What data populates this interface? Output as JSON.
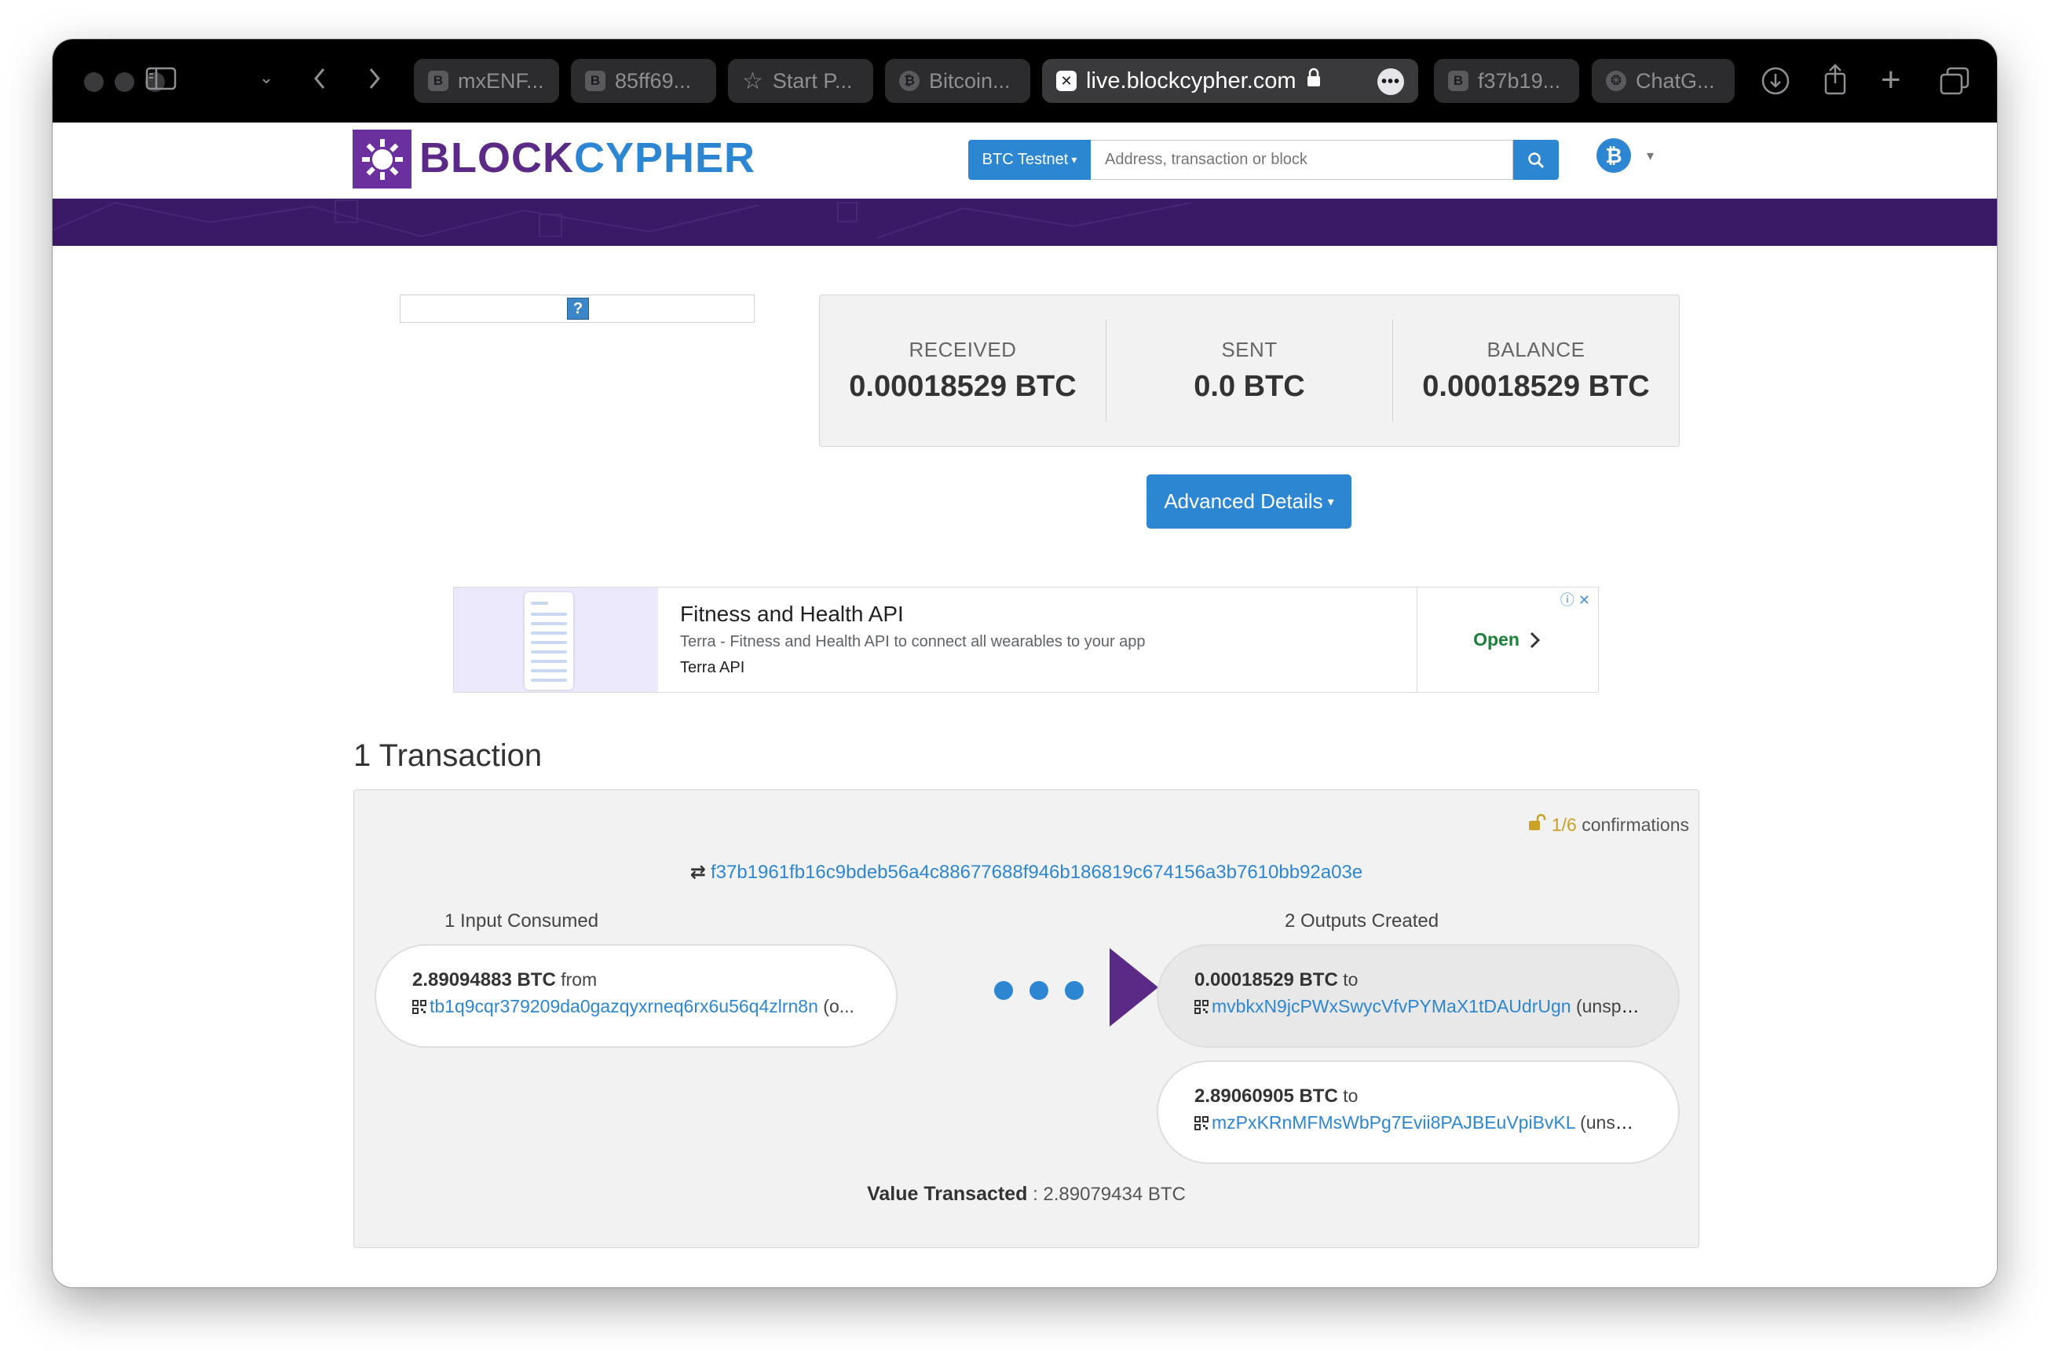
{
  "browser": {
    "tabs": [
      {
        "label": "mxENF...",
        "icon": "B"
      },
      {
        "label": "85ff69...",
        "icon": "B"
      },
      {
        "label": "Start P...",
        "icon": "star-icon"
      },
      {
        "label": "Bitcoin...",
        "icon": "bitcoin-icon"
      },
      {
        "label": "f37b19...",
        "icon": "B"
      },
      {
        "label": "ChatG...",
        "icon": "chatgpt-icon"
      }
    ],
    "active_tab": {
      "url": "live.blockcypher.com"
    }
  },
  "header": {
    "logo": {
      "part1": "BLOCK",
      "part2": "CYPHER"
    },
    "network_label": "BTC Testnet",
    "search_placeholder": "Address, transaction or block"
  },
  "summary": {
    "received": {
      "label": "RECEIVED",
      "value": "0.00018529 BTC"
    },
    "sent": {
      "label": "SENT",
      "value": "0.0 BTC"
    },
    "balance": {
      "label": "BALANCE",
      "value": "0.00018529 BTC"
    }
  },
  "advanced_button": "Advanced Details",
  "qr_help": "?",
  "ad": {
    "title": "Fitness and Health API",
    "description": "Terra - Fitness and Health API to connect all wearables to your app",
    "source": "Terra API",
    "cta": "Open"
  },
  "transactions": {
    "title": "1 Transaction",
    "tx": {
      "confirmations_num": "1/6",
      "confirmations_label": "confirmations",
      "hash": "f37b1961fb16c9bdeb56a4c88677688f946b186819c674156a3b7610bb92a03e",
      "inputs_title": "1 Input Consumed",
      "outputs_title": "2 Outputs Created",
      "inputs": [
        {
          "amount": "2.89094883 BTC",
          "direction": "from",
          "address": "tb1q9cqr379209da0gazqyxrneq6rx6u56q4zlrn8n",
          "status": "(o..."
        }
      ],
      "outputs": [
        {
          "amount": "0.00018529 BTC",
          "direction": "to",
          "address": "mvbkxN9jcPWxSwycVfvPYMaX1tDAUdrUgn",
          "status": "(unspent)"
        },
        {
          "amount": "2.89060905 BTC",
          "direction": "to",
          "address": "mzPxKRnMFMsWbPg7Evii8PAJBEuVpiBvKL",
          "status": "(unspent)"
        }
      ],
      "value_label": "Value Transacted",
      "value": ": 2.89079434 BTC"
    }
  }
}
